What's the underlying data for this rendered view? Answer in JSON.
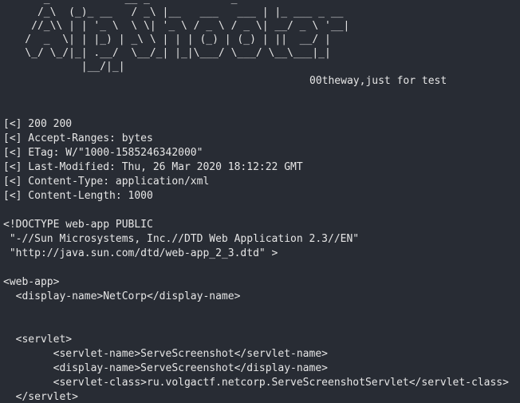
{
  "colors": {
    "background": "#282c34",
    "foreground": "#e6e6e6"
  },
  "banner_ascii": "       _            __ _             _\n      /_\\  (_)_ __   / _\\ |__   ___   ___ | |_ ___ _ __\n     //_\\\\ | | '_ \\  \\ \\| '_ \\ / _ \\ / _ \\| __/ _ \\ '__|\n    /  _  \\| | |_) | _\\ \\ | | | (_) | (_) | ||  __/ |\n    \\_/ \\_/|_| .__/  \\__/_| |_|\\___/ \\___/ \\__\\___|_|\n             |__/|_|",
  "tagline": "00theway,just for test",
  "response": [
    "[<] 200 200",
    "[<] Accept-Ranges: bytes",
    "[<] ETag: W/\"1000-1585246342000\"",
    "[<] Last-Modified: Thu, 26 Mar 2020 18:12:22 GMT",
    "[<] Content-Type: application/xml",
    "[<] Content-Length: 1000"
  ],
  "body": [
    "<!DOCTYPE web-app PUBLIC",
    " \"-//Sun Microsystems, Inc.//DTD Web Application 2.3//EN\"",
    " \"http://java.sun.com/dtd/web-app_2_3.dtd\" >",
    "",
    "<web-app>",
    "  <display-name>NetCorp</display-name>",
    "",
    "",
    "  <servlet>",
    "        <servlet-name>ServeScreenshot</servlet-name>",
    "        <display-name>ServeScreenshot</display-name>",
    "        <servlet-class>ru.volgactf.netcorp.ServeScreenshotServlet</servlet-class>",
    "  </servlet>"
  ]
}
